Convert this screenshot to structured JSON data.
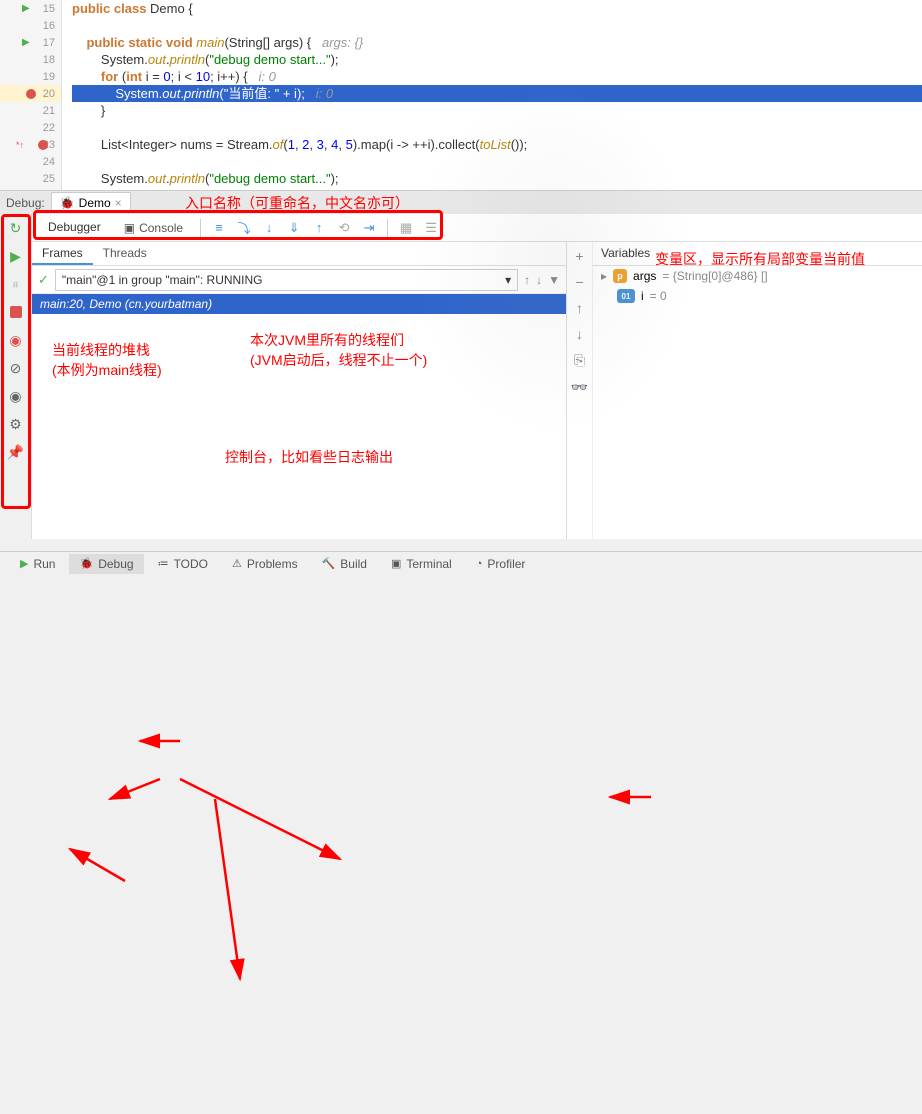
{
  "code": {
    "lines": [
      15,
      16,
      17,
      18,
      19,
      20,
      21,
      22,
      23,
      24,
      25
    ],
    "breakpoint_line": 20,
    "arrow_bp_line": 23,
    "content": {
      "l15": {
        "indent": 0,
        "html": "<span class='kw'>public class</span> Demo {"
      },
      "l16": {
        "indent": 0,
        "html": ""
      },
      "l17": {
        "indent": 2,
        "html": "<span class='kw'>public static void</span> <span class='mth'>main</span>(String[] args) {   <span class='cmt'>args: {}</span>"
      },
      "l18": {
        "indent": 4,
        "html": "System.<span class='mth'>out</span>.<span class='mth'>println</span>(<span class='str'>\"debug demo start...\"</span>);"
      },
      "l19": {
        "indent": 4,
        "html": "<span class='kw'>for</span> (<span class='kw'>int</span> i = <span class='num'>0</span>; i &lt; <span class='num'>10</span>; i++) {   <span class='cmt'>i: 0</span>"
      },
      "l20": {
        "indent": 6,
        "html": "System.<span class='mth'>out</span>.<span class='mth'>println</span>(<span class='str'>\"当前值: \"</span> + i);   <span class='cmt'>i: 0</span>"
      },
      "l21": {
        "indent": 4,
        "html": "}"
      },
      "l22": {
        "indent": 0,
        "html": ""
      },
      "l23": {
        "indent": 4,
        "html": "List&lt;Integer&gt; nums = Stream.<span class='mth'>of</span>(<span class='num'>1</span>, <span class='num'>2</span>, <span class='num'>3</span>, <span class='num'>4</span>, <span class='num'>5</span>).map(i -&gt; ++i).collect(<span class='mth'>toList</span>());"
      },
      "l24": {
        "indent": 0,
        "html": ""
      },
      "l25": {
        "indent": 4,
        "html": "System.<span class='mth'>out</span>.<span class='mth'>println</span>(<span class='str'>\"debug demo start...\"</span>);"
      }
    }
  },
  "debug": {
    "header_label": "Debug:",
    "run_config": "Demo",
    "tabs": {
      "debugger": "Debugger",
      "console": "Console"
    },
    "subtabs": {
      "frames": "Frames",
      "threads": "Threads"
    },
    "thread_text": "\"main\"@1 in group \"main\": RUNNING",
    "frame_text": "main:20, Demo (cn.yourbatman)",
    "variables_label": "Variables",
    "vars": {
      "args": {
        "name": "args",
        "value": "{String[0]@486} []"
      },
      "i": {
        "name": "i",
        "value": "0"
      }
    }
  },
  "bottom": {
    "run": "Run",
    "debug": "Debug",
    "todo": "TODO",
    "problems": "Problems",
    "build": "Build",
    "terminal": "Terminal",
    "profiler": "Profiler"
  },
  "annotations": {
    "entry_name": "入口名称（可重命名，中文名亦可）",
    "stack": "当前线程的堆栈\n(本例为main线程)",
    "threads_anno": "本次JVM里所有的线程们\n(JVM启动后，线程不止一个)",
    "console_anno": "控制台，比如看些日志输出",
    "vars_anno": "变量区，显示所有局部变量当前值"
  }
}
